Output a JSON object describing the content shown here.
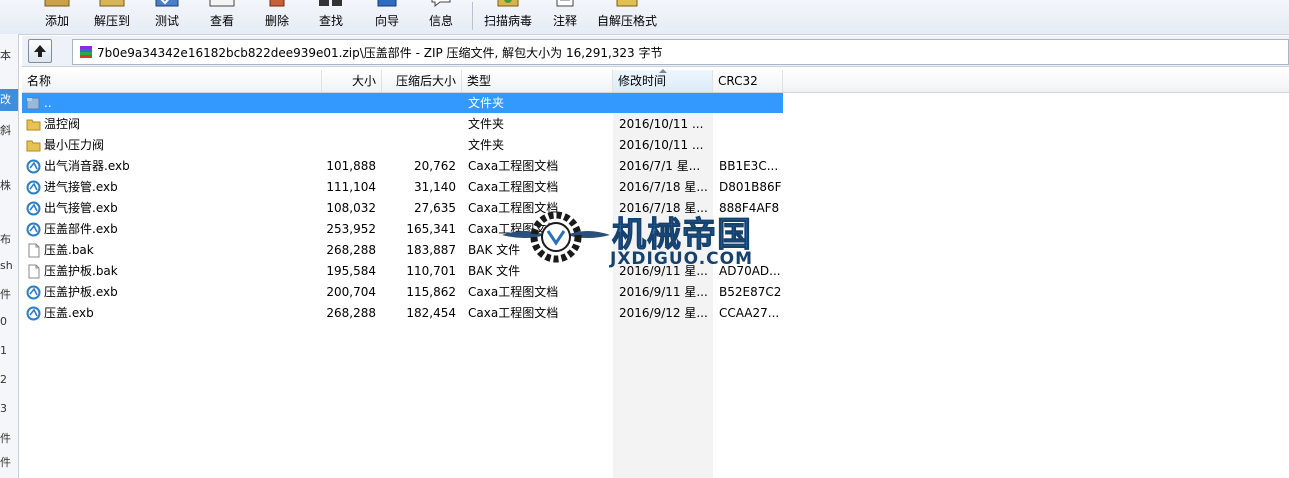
{
  "toolbar": {
    "buttons": [
      {
        "label": "添加",
        "icon": "add-icon"
      },
      {
        "label": "解压到",
        "icon": "extract-icon"
      },
      {
        "label": "测试",
        "icon": "test-icon"
      },
      {
        "label": "查看",
        "icon": "view-icon"
      },
      {
        "label": "删除",
        "icon": "delete-icon"
      },
      {
        "label": "查找",
        "icon": "find-icon"
      },
      {
        "label": "向导",
        "icon": "wizard-icon"
      },
      {
        "label": "信息",
        "icon": "info-icon"
      },
      {
        "label": "扫描病毒",
        "icon": "virus-scan-icon"
      },
      {
        "label": "注释",
        "icon": "comment-icon"
      },
      {
        "label": "自解压格式",
        "icon": "sfx-icon"
      }
    ]
  },
  "left_strip": {
    "items": [
      "本",
      "改",
      "斜",
      "株",
      "布",
      "sh",
      "件",
      "0",
      "1",
      "2",
      "3",
      "件",
      "件"
    ]
  },
  "address": {
    "path": "7b0e9a34342e16182bcb822dee939e01.zip\\压盖部件 - ZIP 压缩文件, 解包大小为 16,291,323 字节"
  },
  "columns": {
    "name": "名称",
    "size": "大小",
    "packed": "压缩后大小",
    "type": "类型",
    "modified": "修改时间",
    "crc": "CRC32"
  },
  "files": [
    {
      "name": "..",
      "size": "",
      "packed": "",
      "type": "文件夹",
      "modified": "",
      "crc": "",
      "icon": "parent-folder-icon"
    },
    {
      "name": "温控阀",
      "size": "",
      "packed": "",
      "type": "文件夹",
      "modified": "2016/10/11 ...",
      "crc": "",
      "icon": "folder-icon"
    },
    {
      "name": "最小压力阀",
      "size": "",
      "packed": "",
      "type": "文件夹",
      "modified": "2016/10/11 ...",
      "crc": "",
      "icon": "folder-icon"
    },
    {
      "name": "出气消音器.exb",
      "size": "101,888",
      "packed": "20,762",
      "type": "Caxa工程图文档",
      "modified": "2016/7/1 星...",
      "crc": "BB1E3C...",
      "icon": "caxa-file-icon"
    },
    {
      "name": "进气接管.exb",
      "size": "111,104",
      "packed": "31,140",
      "type": "Caxa工程图文档",
      "modified": "2016/7/18 星...",
      "crc": "D801B86F",
      "icon": "caxa-file-icon"
    },
    {
      "name": "出气接管.exb",
      "size": "108,032",
      "packed": "27,635",
      "type": "Caxa工程图文档",
      "modified": "2016/7/18 星...",
      "crc": "888F4AF8",
      "icon": "caxa-file-icon"
    },
    {
      "name": "压盖部件.exb",
      "size": "253,952",
      "packed": "165,341",
      "type": "Caxa工程图文档",
      "modified": "",
      "crc": "",
      "icon": "caxa-file-icon"
    },
    {
      "name": "压盖.bak",
      "size": "268,288",
      "packed": "183,887",
      "type": "BAK 文件",
      "modified": "",
      "crc": "",
      "icon": "bak-file-icon"
    },
    {
      "name": "压盖护板.bak",
      "size": "195,584",
      "packed": "110,701",
      "type": "BAK 文件",
      "modified": "2016/9/11 星...",
      "crc": "AD70AD...",
      "icon": "bak-file-icon"
    },
    {
      "name": "压盖护板.exb",
      "size": "200,704",
      "packed": "115,862",
      "type": "Caxa工程图文档",
      "modified": "2016/9/11 星...",
      "crc": "B52E87C2",
      "icon": "caxa-file-icon"
    },
    {
      "name": "压盖.exb",
      "size": "268,288",
      "packed": "182,454",
      "type": "Caxa工程图文档",
      "modified": "2016/9/12 星...",
      "crc": "CCAA27...",
      "icon": "caxa-file-icon"
    }
  ],
  "watermark": {
    "title": "机械帝国",
    "subtitle": "JXDIGUO.COM"
  }
}
